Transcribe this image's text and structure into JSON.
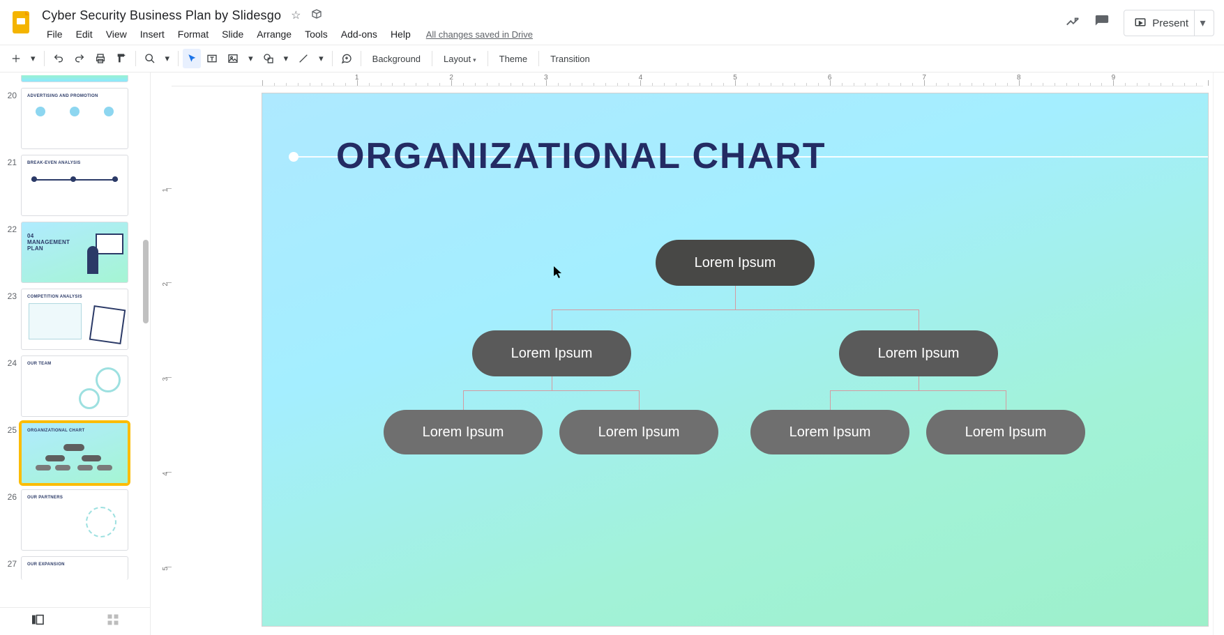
{
  "header": {
    "doc_title": "Cyber Security Business Plan by Slidesgo",
    "menus": [
      "File",
      "Edit",
      "View",
      "Insert",
      "Format",
      "Slide",
      "Arrange",
      "Tools",
      "Add-ons",
      "Help"
    ],
    "save_status": "All changes saved in Drive",
    "present_label": "Present"
  },
  "toolbar": {
    "background": "Background",
    "layout": "Layout",
    "theme": "Theme",
    "transition": "Transition"
  },
  "ruler": {
    "h_labels": [
      "1",
      "2",
      "3",
      "4",
      "5",
      "6",
      "7",
      "8",
      "9"
    ],
    "v_labels": [
      "1",
      "2",
      "3",
      "4",
      "5"
    ]
  },
  "filmstrip": {
    "slides": [
      {
        "num": "20",
        "title": "ADVERTISING AND PROMOTION"
      },
      {
        "num": "21",
        "title": "BREAK-EVEN ANALYSIS"
      },
      {
        "num": "22",
        "title": "04 MANAGEMENT PLAN",
        "grad": true
      },
      {
        "num": "23",
        "title": "COMPETITION ANALYSIS"
      },
      {
        "num": "24",
        "title": "OUR TEAM"
      },
      {
        "num": "25",
        "title": "ORGANIZATIONAL CHART",
        "grad": true,
        "selected": true
      },
      {
        "num": "26",
        "title": "OUR PARTNERS"
      },
      {
        "num": "27",
        "title": "OUR EXPANSION"
      }
    ]
  },
  "slide": {
    "title": "ORGANIZATIONAL CHART",
    "org": {
      "root": "Lorem Ipsum",
      "level2": [
        "Lorem Ipsum",
        "Lorem Ipsum"
      ],
      "level3": [
        "Lorem Ipsum",
        "Lorem Ipsum",
        "Lorem Ipsum",
        "Lorem Ipsum"
      ]
    }
  }
}
